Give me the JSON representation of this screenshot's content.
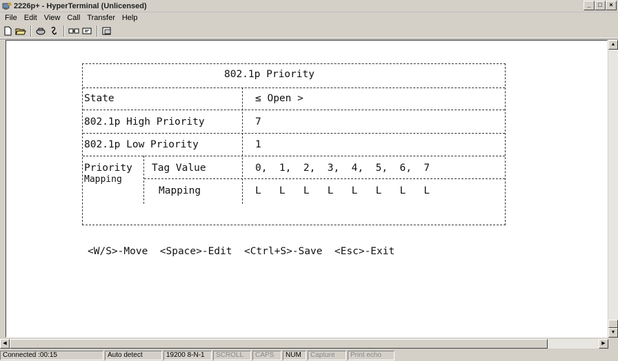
{
  "window": {
    "title": "2226p+ - HyperTerminal (Unlicensed)",
    "controls": [
      "_",
      "□",
      "×"
    ]
  },
  "menu": [
    "File",
    "Edit",
    "View",
    "Call",
    "Transfer",
    "Help"
  ],
  "toolbar": [
    "new-icon",
    "open-icon",
    "disconnect-icon",
    "properties-icon",
    "send-icon",
    "receive-icon",
    "settings-icon"
  ],
  "screen": {
    "heading": "802.1p Priority",
    "rows": [
      {
        "label": "State",
        "value": "≤ Open >"
      },
      {
        "label": "802.1p High Priority",
        "value": "7"
      },
      {
        "label": "802.1p Low Priority",
        "value": "1"
      }
    ],
    "mapping": {
      "group_label_line1": "Priority",
      "group_label_line2": "Mapping",
      "tag_label": "Tag Value",
      "tag_values": "0,  1,  2,  3,  4,  5,  6,  7",
      "map_label": "Mapping",
      "map_values": "L   L   L   L   L   L   L   L"
    },
    "help": "<W/S>-Move  <Space>-Edit  <Ctrl+S>-Save  <Esc>-Exit"
  },
  "status": {
    "connected": "Connected :00:15",
    "detect": "Auto detect",
    "port": "19200 8-N-1",
    "scroll": "SCROLL",
    "caps": "CAPS",
    "num": "NUM",
    "capture": "Capture",
    "print": "Print echo"
  }
}
